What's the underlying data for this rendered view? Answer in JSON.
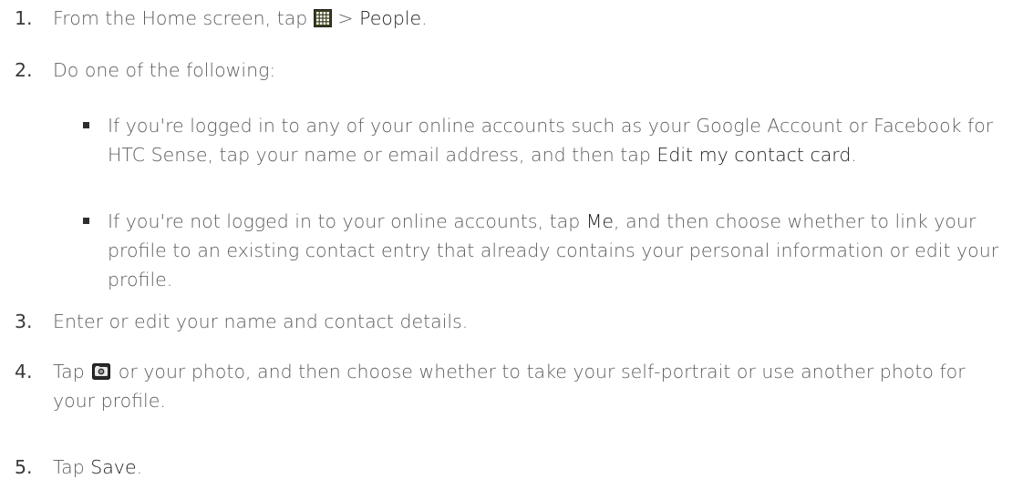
{
  "steps": [
    {
      "number": "1.",
      "parts": {
        "a": "From the Home screen, tap",
        "b": " > ",
        "c": "People",
        "d": "."
      },
      "icon": "all-apps-grid-icon"
    },
    {
      "number": "2.",
      "text": "Do one of the following:",
      "bullets": [
        {
          "a": "If you're logged in to any of your online accounts such as your Google Account or Facebook for HTC Sense, tap your name or email address, and then tap ",
          "b": "Edit my contact card",
          "c": "."
        },
        {
          "a": "If you're not logged in to your online accounts, tap ",
          "b": "Me",
          "c": ", and then choose whether to link your profile to an existing contact entry that already contains your personal information or edit your profile."
        }
      ]
    },
    {
      "number": "3.",
      "text": "Enter or edit your name and contact details."
    },
    {
      "number": "4.",
      "parts": {
        "a": "Tap",
        "b": "or your photo, and then choose whether to take your self-portrait or use another photo for your profile."
      },
      "icon": "camera-icon"
    },
    {
      "number": "5.",
      "parts": {
        "a": "Tap ",
        "b": "Save",
        "c": "."
      }
    }
  ]
}
